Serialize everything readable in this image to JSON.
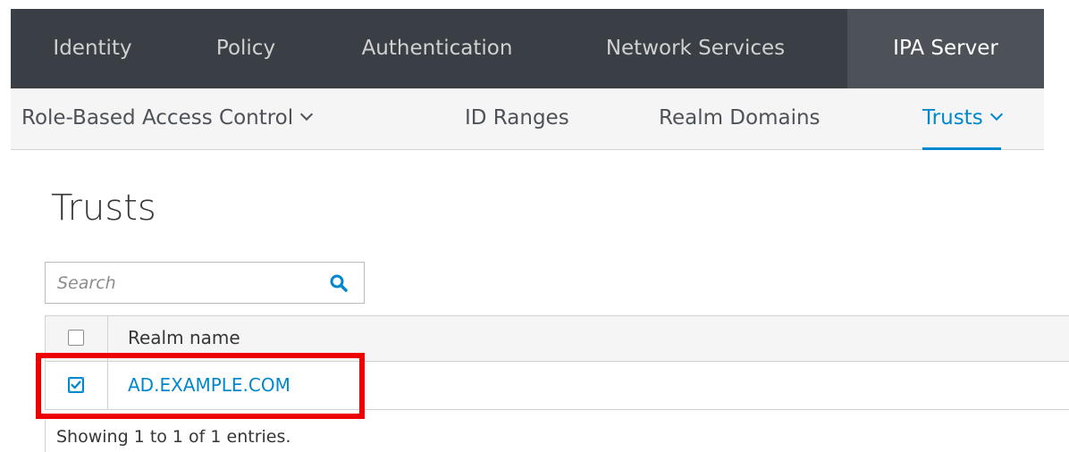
{
  "top_nav": {
    "items": [
      {
        "label": "Identity",
        "active": false
      },
      {
        "label": "Policy",
        "active": false
      },
      {
        "label": "Authentication",
        "active": false
      },
      {
        "label": "Network Services",
        "active": false
      },
      {
        "label": "IPA Server",
        "active": true
      }
    ]
  },
  "sub_nav": {
    "items": [
      {
        "label": "Role-Based Access Control",
        "has_dropdown": true,
        "active": false
      },
      {
        "label": "ID Ranges",
        "has_dropdown": false,
        "active": false
      },
      {
        "label": "Realm Domains",
        "has_dropdown": false,
        "active": false
      },
      {
        "label": "Trusts",
        "has_dropdown": true,
        "active": true
      }
    ]
  },
  "page": {
    "title": "Trusts"
  },
  "search": {
    "placeholder": "Search",
    "value": "",
    "icon": "search-icon"
  },
  "table": {
    "columns": [
      "Realm name"
    ],
    "header_checkbox_checked": false,
    "rows": [
      {
        "realm_name": "AD.EXAMPLE.COM",
        "checked": true
      }
    ],
    "footer": "Showing 1 to 1 of 1 entries."
  },
  "colors": {
    "nav_bg": "#393f44",
    "nav_active_bg": "#4d5258",
    "accent": "#0088ce",
    "highlight": "#ee0000"
  }
}
